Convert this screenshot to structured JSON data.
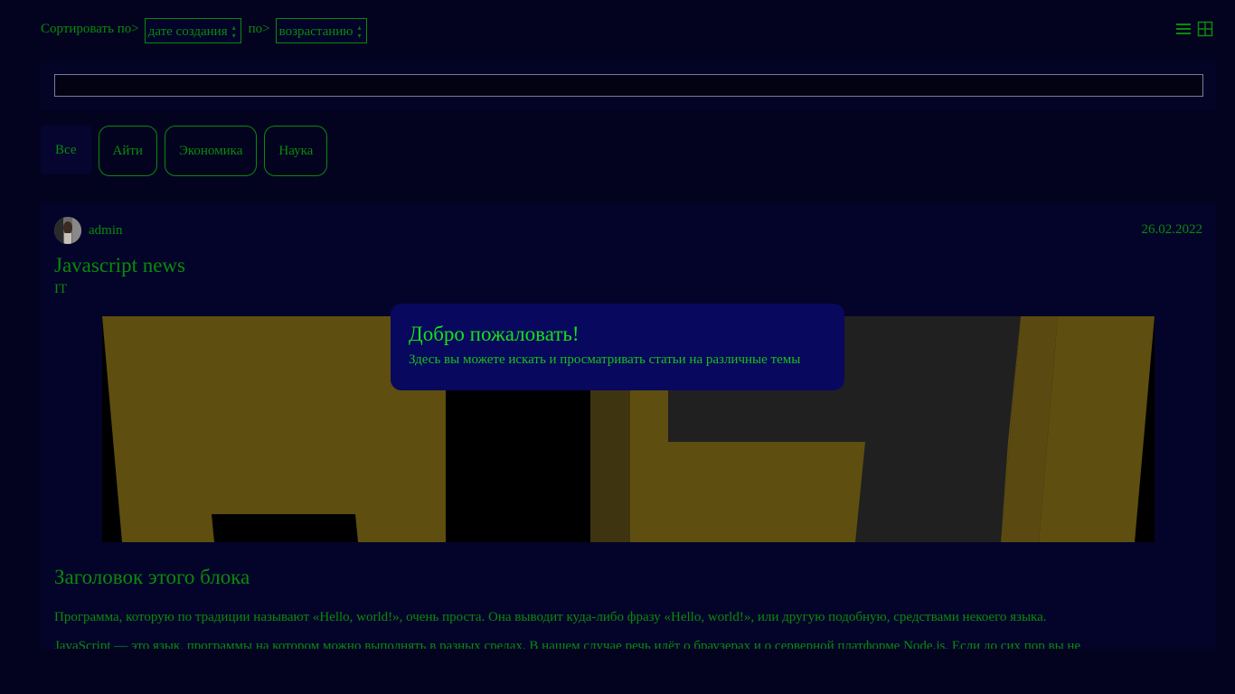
{
  "sort": {
    "label1": "Сортировать по>",
    "field_value": "дате создания",
    "label2": "по>",
    "order_value": "возрастанию"
  },
  "view_icons": [
    "list-icon",
    "grid-icon"
  ],
  "search": {
    "value": "",
    "placeholder": ""
  },
  "tabs": [
    {
      "label": "Все",
      "active": true
    },
    {
      "label": "Айти"
    },
    {
      "label": "Экономика"
    },
    {
      "label": "Наука"
    }
  ],
  "post": {
    "author": "admin",
    "date": "26.02.2022",
    "title": "Javascript news",
    "category": "IT",
    "block_title": "Заголовок этого блока",
    "paragraphs": [
      "Программа, которую по традиции называют «Hello, world!», очень проста. Она выводит куда-либо фразу «Hello, world!», или другую подобную, средствами некоего языка.",
      "JavaScript — это язык, программы на котором можно выполнять в разных средах. В нашем случае речь идёт о браузерах и о серверной платформе Node.js. Если до сих пор вы не"
    ]
  },
  "toast": {
    "title": "Добро пожаловать!",
    "subtitle": "Здесь вы можете искать и просматривать статьи на различные темы"
  },
  "colors": {
    "background": "#030320",
    "text": "#0a8a0a",
    "toast_bg": "#08085e",
    "toast_text": "#16e016"
  }
}
